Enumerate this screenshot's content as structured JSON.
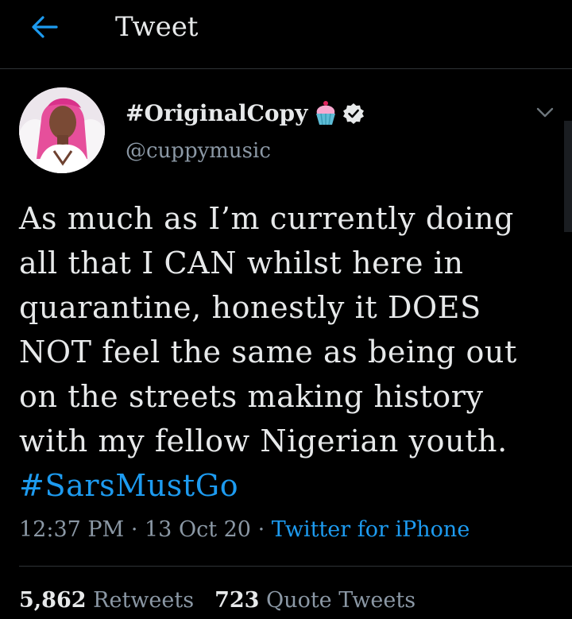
{
  "header": {
    "title": "Tweet",
    "back_icon": "arrow-left-icon"
  },
  "author": {
    "display_name": "#OriginalCopy",
    "emoji": "cupcake-icon",
    "verified_icon": "verified-badge-icon",
    "handle": "@cuppymusic",
    "avatar": "avatar-photo"
  },
  "tweet": {
    "text": "As much as I’m currently doing all that I CAN whilst here in quarantine, honestly it DOES NOT feel the same as being out on the streets making history with my fellow Nigerian youth.",
    "hashtag": "#SarsMustGo"
  },
  "meta": {
    "time": "12:37 PM",
    "separator": "·",
    "date": "13 Oct 20",
    "source": "Twitter for iPhone"
  },
  "stats": {
    "retweets_count": "5,862",
    "retweets_label": "Retweets",
    "quotes_count": "723",
    "quotes_label": "Quote Tweets"
  },
  "colors": {
    "background": "#000000",
    "accent": "#1d9bf0",
    "muted": "#8b98a5",
    "text": "#e7e9ea"
  }
}
